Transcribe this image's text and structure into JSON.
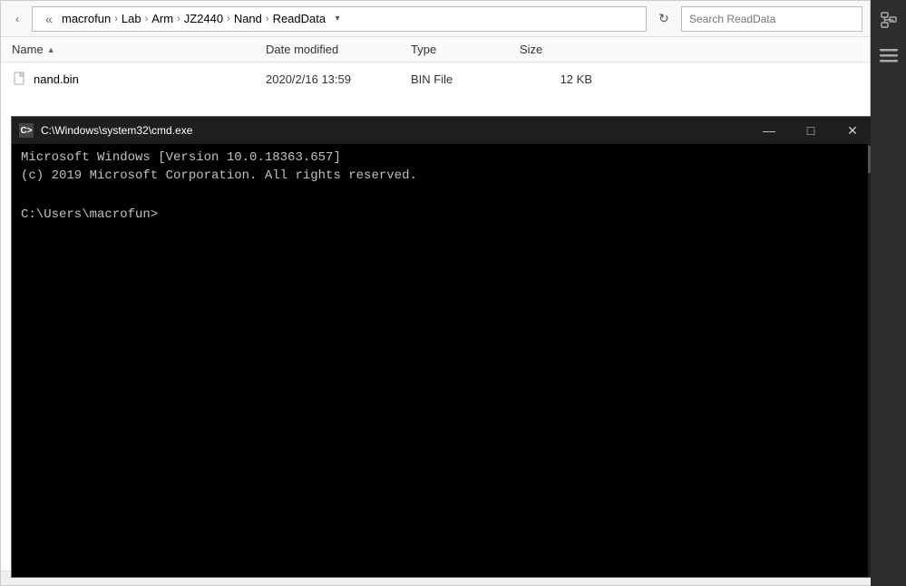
{
  "explorer": {
    "breadcrumb": {
      "items": [
        "macrofun",
        "Lab",
        "Arm",
        "JZ2440",
        "Nand",
        "ReadData"
      ]
    },
    "search_placeholder": "Search ReadData",
    "columns": {
      "name": "Name",
      "date_modified": "Date modified",
      "type": "Type",
      "size": "Size"
    },
    "files": [
      {
        "name": "nand.bin",
        "date_modified": "2020/2/16 13:59",
        "type": "BIN File",
        "size": "12 KB"
      }
    ]
  },
  "cmd": {
    "title": "C:\\Windows\\system32\\cmd.exe",
    "icon_label": "C>",
    "lines": [
      "Microsoft Windows [Version 10.0.18363.657]",
      "(c) 2019 Microsoft Corporation. All rights reserved.",
      "",
      "C:\\Users\\macrofun>"
    ],
    "minimize_label": "—",
    "maximize_label": "□",
    "close_label": "✕"
  },
  "sidebar": {
    "icons": [
      "🔗",
      "≡"
    ]
  }
}
